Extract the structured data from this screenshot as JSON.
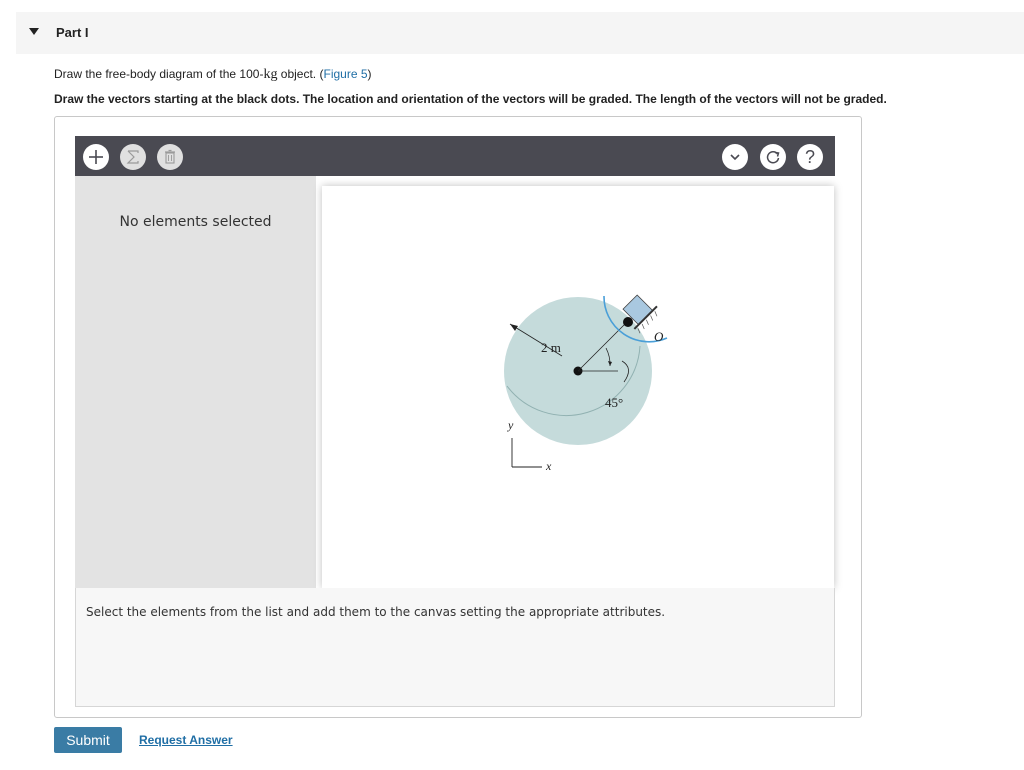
{
  "part": {
    "title": "Part I",
    "toggle_icon": "caret-down-icon"
  },
  "instruction": {
    "prefix": "Draw the free-body diagram of the 100-",
    "unit": "kg",
    "middle": " object. (",
    "figure_link": "Figure 5",
    "suffix": ")"
  },
  "bold_instruction": "Draw the vectors starting at the black dots. The location and orientation of the vectors will be graded. The length of the vectors will not be graded.",
  "toolbar": {
    "add_icon": "plus-icon",
    "sum_icon": "sigma-icon",
    "delete_icon": "trash-icon",
    "dropdown_icon": "chevron-down-icon",
    "reset_icon": "reset-icon",
    "help_icon": "help-icon",
    "help_label": "?"
  },
  "left_panel": {
    "empty_text": "No elements selected"
  },
  "diagram": {
    "radius_label": "2 m",
    "angle_label": "45°",
    "pin_label": "O",
    "axis_y": "y",
    "axis_x": "x",
    "disk_color": "#c5dbdb",
    "arc_color": "#4a9fd8"
  },
  "bottom_panel": {
    "text": "Select the elements from the list and add them to the canvas setting the appropriate attributes."
  },
  "actions": {
    "submit_label": "Submit",
    "request_label": "Request Answer"
  },
  "colors": {
    "toolbar_bg": "#4a4a52",
    "submit_bg": "#3a7ca5",
    "link": "#1f6ea5"
  }
}
